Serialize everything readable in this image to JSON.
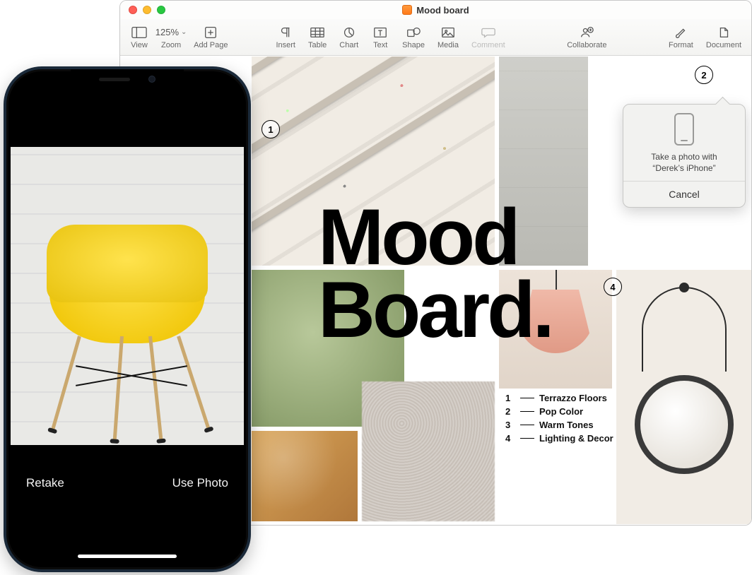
{
  "window": {
    "title": "Mood board",
    "traffic": {
      "close": "close",
      "min": "minimize",
      "max": "zoom"
    }
  },
  "toolbar": {
    "view": "View",
    "zoom_label": "Zoom",
    "zoom_value": "125%",
    "add_page": "Add Page",
    "insert": "Insert",
    "table": "Table",
    "chart": "Chart",
    "text": "Text",
    "shape": "Shape",
    "media": "Media",
    "comment": "Comment",
    "collaborate": "Collaborate",
    "format": "Format",
    "document": "Document"
  },
  "canvas": {
    "title_line1": "Mood",
    "title_line2": "Board.",
    "markers": {
      "m1": "1",
      "m2": "2",
      "m4": "4"
    },
    "legend": [
      {
        "n": "1",
        "label": "Terrazzo Floors"
      },
      {
        "n": "2",
        "label": "Pop Color"
      },
      {
        "n": "3",
        "label": "Warm Tones"
      },
      {
        "n": "4",
        "label": "Lighting & Decor"
      }
    ]
  },
  "popover": {
    "line1": "Take a photo with",
    "line2": "“Derek’s iPhone”",
    "cancel": "Cancel"
  },
  "iphone": {
    "retake": "Retake",
    "use_photo": "Use Photo"
  }
}
